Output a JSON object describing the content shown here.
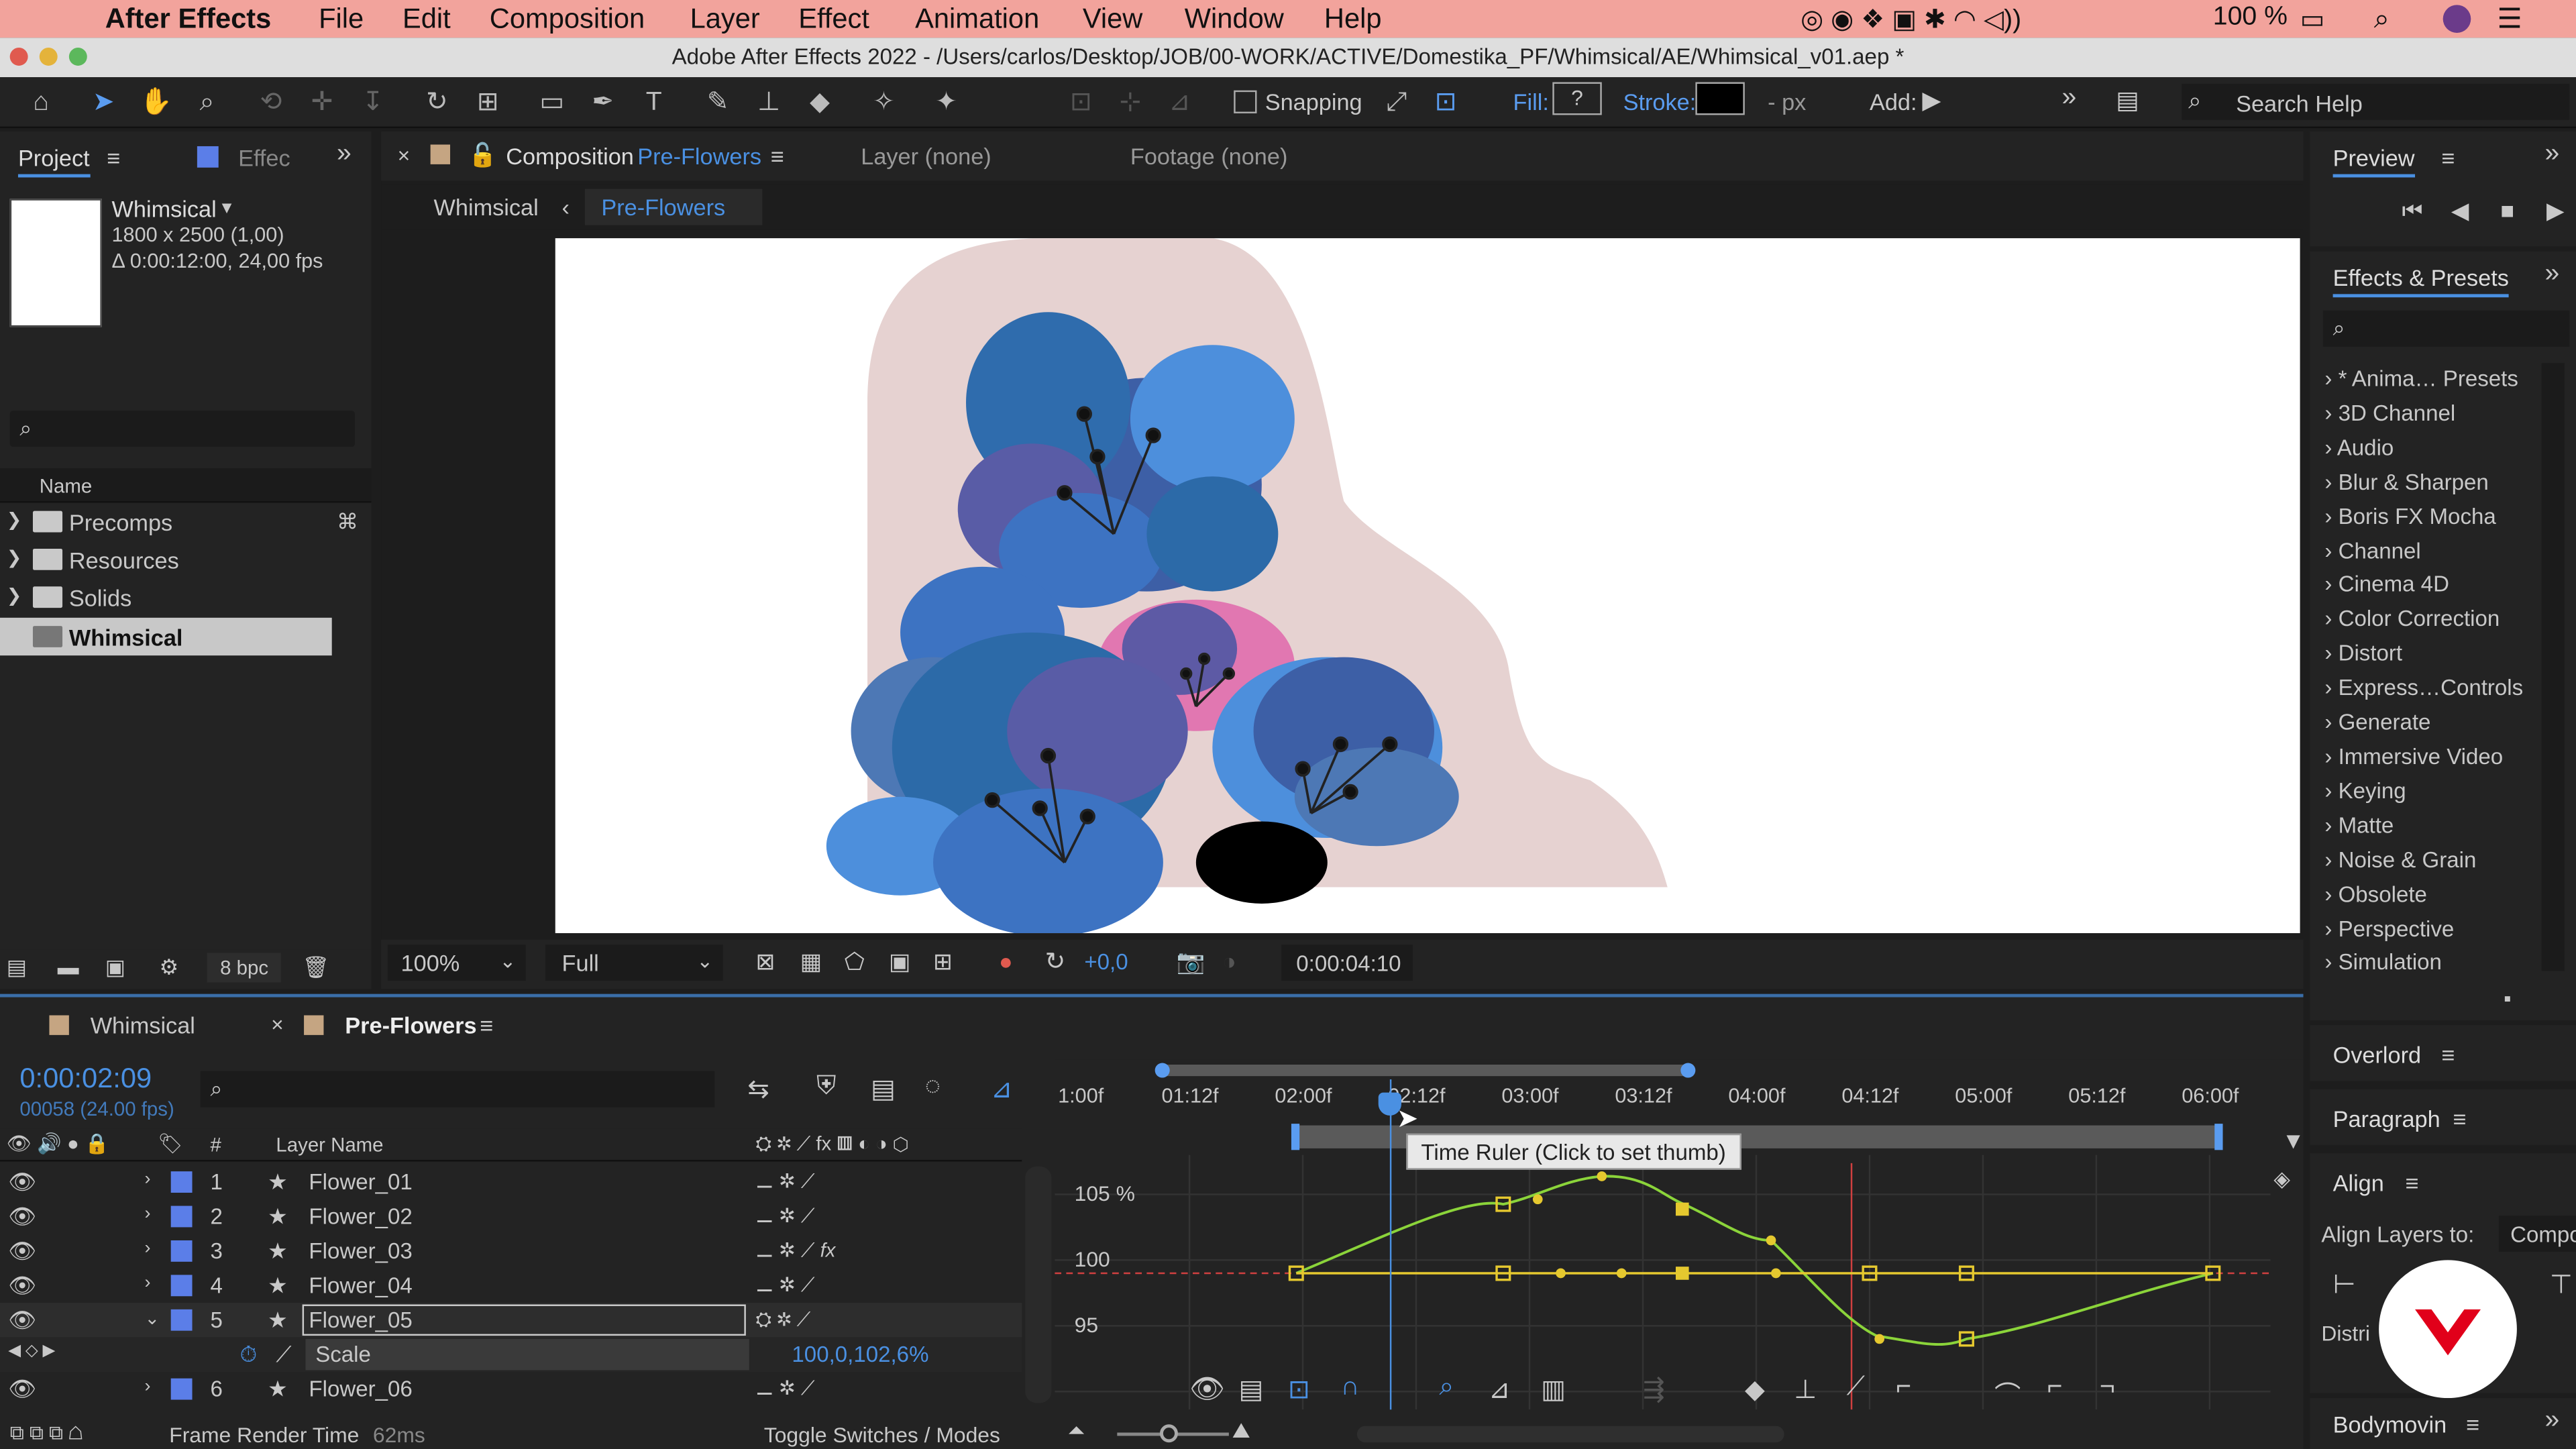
{
  "menubar": {
    "apple": "",
    "app": "After Effects",
    "items": [
      "File",
      "Edit",
      "Composition",
      "Layer",
      "Effect",
      "Animation",
      "View",
      "Window",
      "Help"
    ],
    "battery": "100 %"
  },
  "window": {
    "title": "Adobe After Effects 2022 - /Users/carlos/Desktop/JOB/00-WORK/ACTIVE/Domestika_PF/Whimsical/AE/Whimsical_v01.aep *"
  },
  "toolbar": {
    "snapping": "Snapping",
    "fill": "Fill:",
    "fill_value": "?",
    "stroke": "Stroke:",
    "px": "- px",
    "add": "Add:",
    "search": "Search Help"
  },
  "project": {
    "tab": "Project",
    "tab2": "Effec",
    "comp_name": "Whimsical",
    "comp_size": "1800 x 2500 (1,00)",
    "comp_duration": "Δ 0:00:12:00, 24,00 fps",
    "col_name": "Name",
    "items": [
      {
        "name": "Precomps"
      },
      {
        "name": "Resources"
      },
      {
        "name": "Solids"
      },
      {
        "name": "Whimsical"
      }
    ],
    "bpc": "8 bpc"
  },
  "comp_panel": {
    "tab_prefix": "Composition",
    "tab_name": "Pre-Flowers",
    "layer_tab": "Layer (none)",
    "footage_tab": "Footage (none)",
    "crumb1": "Whimsical",
    "crumb2": "Pre-Flowers",
    "zoom": "100%",
    "quality": "Full",
    "exposure": "+0,0",
    "timecode": "0:00:04:10"
  },
  "preview": {
    "title": "Preview"
  },
  "effects": {
    "title": "Effects & Presets",
    "items": [
      "* Anima… Presets",
      "3D Channel",
      "Audio",
      "Blur & Sharpen",
      "Boris FX Mocha",
      "Channel",
      "Cinema 4D",
      "Color Correction",
      "Distort",
      "Express…Controls",
      "Generate",
      "Immersive Video",
      "Keying",
      "Matte",
      "Noise & Grain",
      "Obsolete",
      "Perspective",
      "Simulation"
    ]
  },
  "overlord": {
    "title": "Overlord"
  },
  "paragraph": {
    "title": "Paragraph"
  },
  "align": {
    "title": "Align",
    "align_to": "Align Layers to:",
    "target": "Compo",
    "distri": "Distri"
  },
  "bodymovin": {
    "title": "Bodymovin"
  },
  "timeline": {
    "tab1": "Whimsical",
    "tab2": "Pre-Flowers",
    "time": "0:00:02:09",
    "frames": "00058 (24.00 fps)",
    "col_num": "#",
    "col_name": "Layer Name",
    "layers": [
      {
        "num": "1",
        "name": "Flower_01"
      },
      {
        "num": "2",
        "name": "Flower_02"
      },
      {
        "num": "3",
        "name": "Flower_03"
      },
      {
        "num": "4",
        "name": "Flower_04"
      },
      {
        "num": "5",
        "name": "Flower_05"
      },
      {
        "num": "6",
        "name": "Flower_06"
      }
    ],
    "prop_name": "Scale",
    "prop_value": "100,0,102,6%",
    "ruler": [
      "1:00f",
      "01:12f",
      "02:00f",
      "02:12f",
      "03:00f",
      "03:12f",
      "04:00f",
      "04:12f",
      "05:00f",
      "05:12f",
      "06:00f"
    ],
    "tooltip": "Time Ruler (Click to set thumb)",
    "graph_labels": [
      "105 %",
      "100",
      "95"
    ],
    "frame_render": "Frame Render Time",
    "frame_render_value": "62ms",
    "toggle": "Toggle Switches / Modes"
  }
}
